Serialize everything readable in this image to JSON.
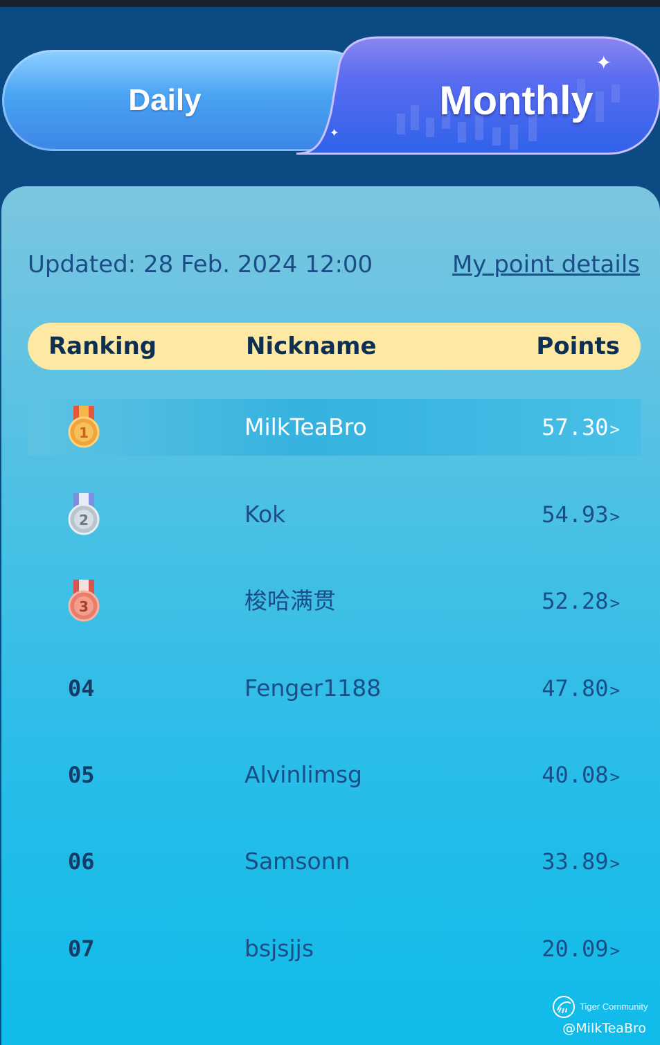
{
  "tabs": [
    {
      "label": "Daily",
      "active": false
    },
    {
      "label": "Monthly",
      "active": true
    }
  ],
  "updated_text": "Updated: 28 Feb. 2024 12:00",
  "details_link": "My point details",
  "columns": {
    "ranking": "Ranking",
    "nickname": "Nickname",
    "points": "Points"
  },
  "rows": [
    {
      "rank": "1",
      "medal": "gold-medal",
      "nickname": "MilkTeaBro",
      "points": "57.30",
      "highlighted": true
    },
    {
      "rank": "2",
      "medal": "silver-medal",
      "nickname": "Kok",
      "points": "54.93"
    },
    {
      "rank": "3",
      "medal": "bronze-medal",
      "nickname": "梭哈满贯",
      "points": "52.28"
    },
    {
      "rank": "04",
      "nickname": "Fenger1188",
      "points": "47.80"
    },
    {
      "rank": "05",
      "nickname": "Alvinlimsg",
      "points": "40.08"
    },
    {
      "rank": "06",
      "nickname": "Samsonn",
      "points": "33.89"
    },
    {
      "rank": "07",
      "nickname": "bsjsjjs",
      "points": "20.09"
    }
  ],
  "chevron": ">",
  "watermark": {
    "brand": "Tiger Community",
    "handle": "@MilkTeaBro"
  },
  "colors": {
    "background": "#0b4a82",
    "header_band": "#fde9a4",
    "text": "#1b4d86",
    "gold": "#f2a43a",
    "silver": "#b9c4cf",
    "bronze": "#e77d6a"
  }
}
